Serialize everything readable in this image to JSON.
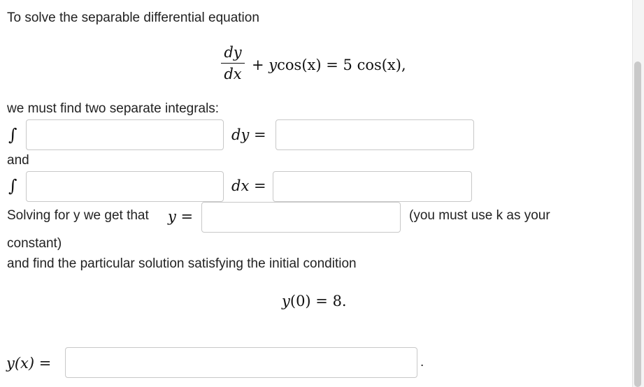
{
  "intro": "To solve the separable differential equation",
  "equation": {
    "numerator": "dy",
    "denominator": "dx",
    "plus_y": "+ y",
    "cos_x": "cos(x)",
    "eq": " = 5",
    "cos_x2": "cos(x),"
  },
  "integrals_prompt": "we must find two separate integrals:",
  "integral_symbol": "∫",
  "dy_eq": "dy =",
  "and_label": "and",
  "dx_eq": "dx =",
  "solving": {
    "text": "Solving for y we get that",
    "y_eq": "y =",
    "note_line1": "(you must use k as your",
    "note_line2": "constant)"
  },
  "particular_prompt": "and find the particular solution satisfying the initial condition",
  "initial_condition": {
    "y": "y",
    "arg": "(0) = 8."
  },
  "final": {
    "yx": "y(x) =",
    "period": "."
  }
}
